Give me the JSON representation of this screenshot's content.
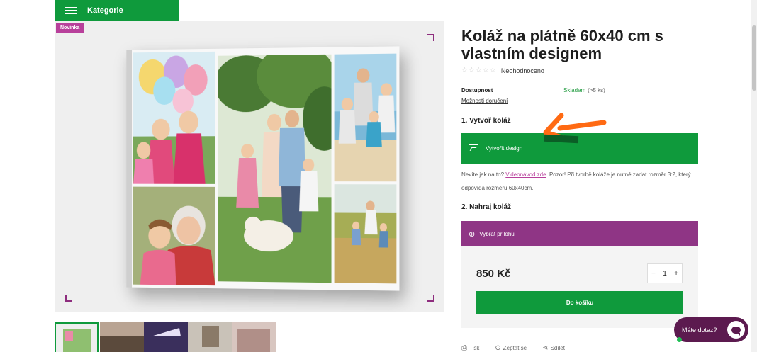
{
  "header": {
    "category_label": "Kategorie"
  },
  "gallery": {
    "badge": "Novinka",
    "thumbnail_count": 5
  },
  "product": {
    "title": "Koláž na plátně 60x40 cm s vlastním designem",
    "stars": "☆☆☆☆☆",
    "rating_label": "Neohodnoceno",
    "availability_label": "Dostupnost",
    "availability_value": "Skladem",
    "availability_note": "(>5 ks)",
    "delivery_link": "Možnosti doručení",
    "step1": "1. Vytvoř koláž",
    "create_design": "Vytvořit design",
    "help_prefix": "Nevíte jak na to?",
    "help_video": "Videonávod zde",
    "help_suffix": ". Pozor! Při tvorbě koláže je nutné zadat rozměr 3:2, který odpovídá rozměru 60x40cm.",
    "step2": "2. Nahraj koláž",
    "upload": "Vybrat přílohu",
    "price": "850 Kč",
    "qty_minus": "−",
    "qty_value": "1",
    "qty_plus": "+",
    "add_to_cart": "Do košíku"
  },
  "actions": {
    "print": "Tisk",
    "ask": "Zeptat se",
    "share": "Sdílet"
  },
  "chat": {
    "label": "Máte dotaz?"
  },
  "colors": {
    "green": "#0f9a3c",
    "purple": "#8f3585",
    "chat": "#5c1a4f",
    "annotation_arrow": "#ff6a13"
  }
}
